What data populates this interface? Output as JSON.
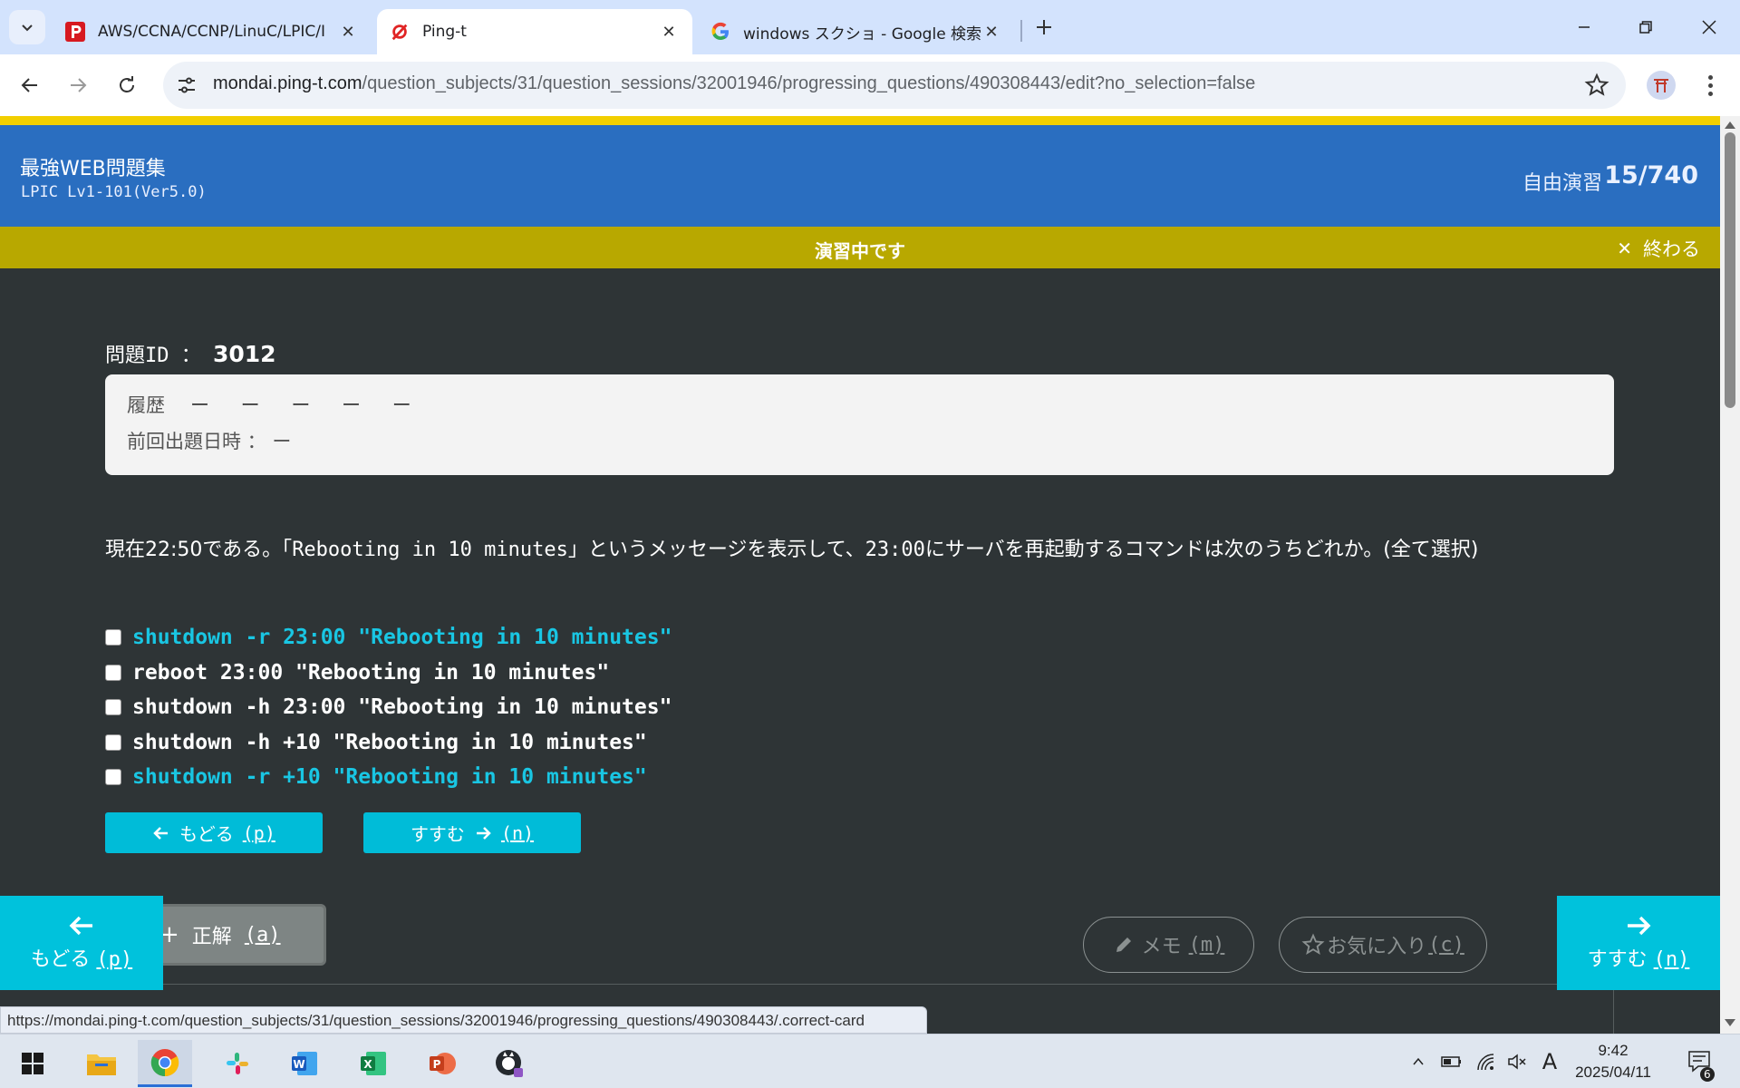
{
  "browser": {
    "tabs": [
      {
        "title": "AWS/CCNA/CCNP/LinuC/LPIC/I",
        "close": "✕"
      },
      {
        "title": "Ping-t",
        "close": "✕"
      },
      {
        "title": "windows スクショ - Google 検索",
        "close": "✕"
      }
    ],
    "new_tab": "+",
    "url_host": "mondai.ping-t.com",
    "url_path": "/question_subjects/31/question_sessions/32001946/progressing_questions/490308443/edit?no_selection=false"
  },
  "header": {
    "site_title": "最強WEB問題集",
    "subtitle": "LPIC Lv1-101(Ver5.0)",
    "mode": "自由演習",
    "progress": "15/740"
  },
  "status": {
    "text": "演習中です",
    "finish": "終わる",
    "finish_icon": "✕"
  },
  "question": {
    "id_label": "問題ID ： ",
    "id": "3012",
    "history_label": "履歴",
    "history_values": "ー ー ー ー ー",
    "last_label": "前回出題日時 ： ー",
    "text_pre": "現在22:50である。「",
    "text_code": "Rebooting in 10 minutes",
    "text_mid": "」というメッセージを表示して、",
    "text_code2": "23:00",
    "text_post": "にサーバを再起動するコマンドは次のうちどれか。(全て選択)",
    "options": [
      {
        "text": "shutdown -r 23:00 \"Rebooting in 10 minutes\"",
        "highlight": true
      },
      {
        "text": "reboot 23:00 \"Rebooting in 10 minutes\"",
        "highlight": false
      },
      {
        "text": "shutdown -h 23:00 \"Rebooting in 10 minutes\"",
        "highlight": false
      },
      {
        "text": "shutdown -h +10 \"Rebooting in 10 minutes\"",
        "highlight": false
      },
      {
        "text": "shutdown -r +10 \"Rebooting in 10 minutes\"",
        "highlight": true
      }
    ]
  },
  "controls": {
    "back_label": "もどる",
    "back_key": "(p)",
    "next_label": "すすむ",
    "next_key": "(n)",
    "answer_label": "正解",
    "answer_key": "(a)",
    "memo_label": "メモ",
    "memo_key": "(m)",
    "fav_label": "お気に入り",
    "fav_key": "(c)"
  },
  "status_url": "https://mondai.ping-t.com/question_subjects/31/question_sessions/32001946/progressing_questions/490308443/.correct-card",
  "taskbar": {
    "time": "9:42",
    "date": "2025/04/11",
    "ime": "A",
    "notifications": "6"
  },
  "colors": {
    "header_blue": "#2a6ec0",
    "status_olive": "#b8a800",
    "accent_cyan": "#00bcd8",
    "highlight_text": "#19c6e3",
    "background": "#2e3436"
  }
}
